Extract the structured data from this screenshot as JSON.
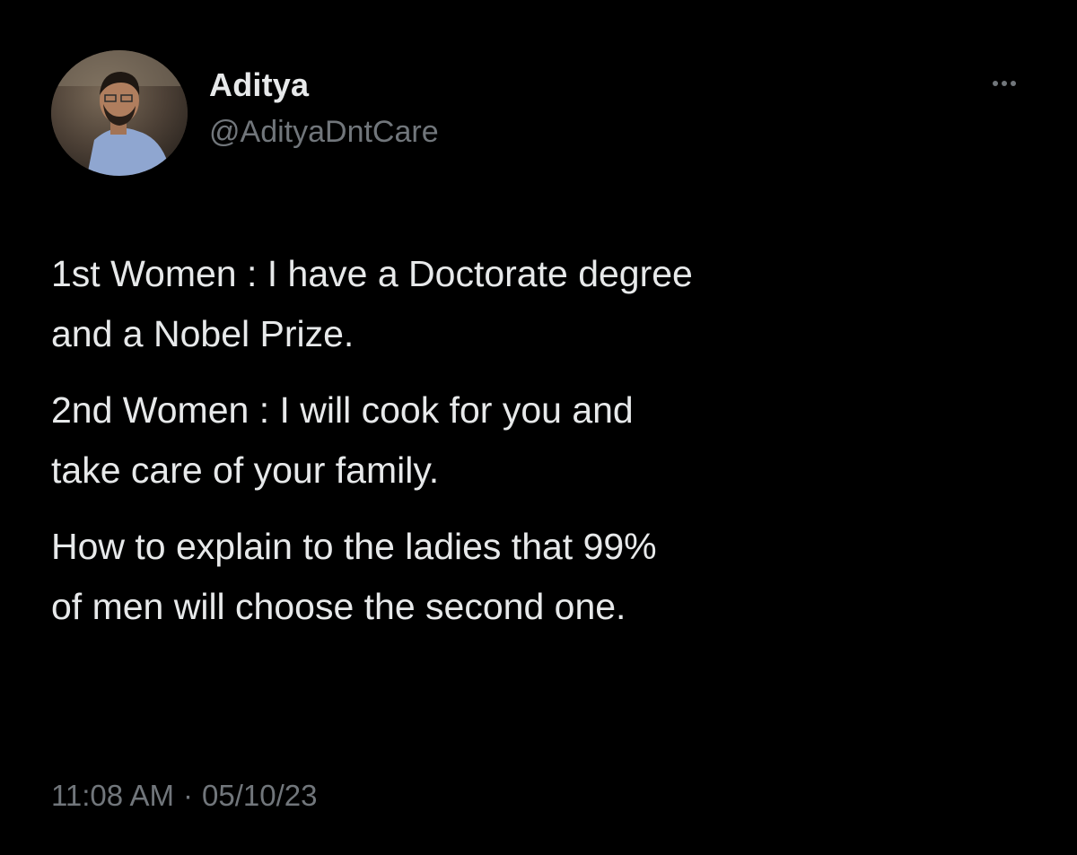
{
  "author": {
    "display_name": "Aditya",
    "handle": "@AdityaDntCare"
  },
  "more_icon": "more-horizontal-icon",
  "tweet": {
    "paragraphs": [
      "1st Women : I have a Doctorate degree\nand a Nobel Prize.",
      "2nd Women : I will cook for you and\ntake care of your family.",
      "How to explain to the ladies that 99%\nof men will choose the second one."
    ]
  },
  "meta": {
    "time": "11:08 AM",
    "separator": "·",
    "date": "05/10/23"
  },
  "colors": {
    "background": "#000000",
    "primary_text": "#e7e9ea",
    "secondary_text": "#71767b"
  }
}
